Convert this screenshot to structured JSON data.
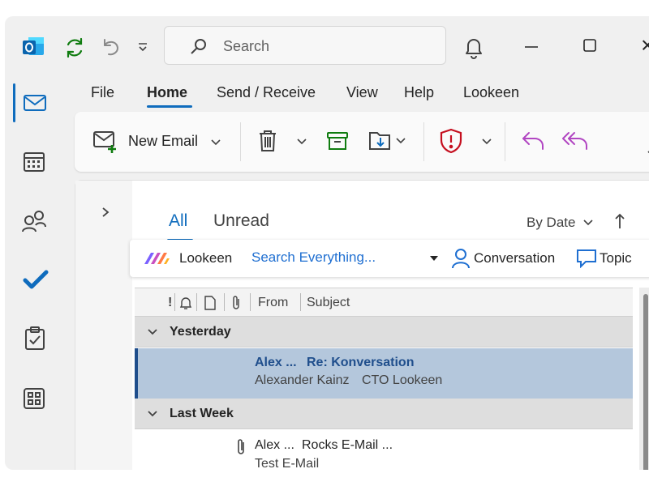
{
  "titlebar": {
    "search_placeholder": "Search",
    "close_glyph": "×"
  },
  "menu": {
    "items": [
      {
        "label": "File"
      },
      {
        "label": "Home"
      },
      {
        "label": "Send / Receive"
      },
      {
        "label": "View"
      },
      {
        "label": "Help"
      },
      {
        "label": "Lookeen"
      }
    ],
    "active": "Home"
  },
  "ribbon": {
    "new_email_label": "New Email"
  },
  "nav_rail": [
    "mail",
    "calendar",
    "people",
    "todo",
    "tasks",
    "apps"
  ],
  "mail_list": {
    "tabs": [
      {
        "label": "All"
      },
      {
        "label": "Unread"
      }
    ],
    "active_tab": "All",
    "sort_label": "By Date"
  },
  "lookeen_bar": {
    "brand_label": "Lookeen",
    "search_placeholder": "Search Everything...",
    "conversation_label": "Conversation",
    "topic_label": "Topic"
  },
  "columns": {
    "importance": "!",
    "from": "From",
    "subject": "Subject"
  },
  "groups": [
    {
      "label": "Yesterday",
      "messages": [
        {
          "from_short": "Alex ...",
          "subject": "Re: Konversation",
          "sender_full": "Alexander Kainz",
          "preview": "CTO Lookeen",
          "selected": true,
          "unread": true
        }
      ]
    },
    {
      "label": "Last Week",
      "messages": [
        {
          "from_short": "Alex ...",
          "subject": "Rocks E-Mail ...",
          "preview": "Test E-Mail",
          "has_attachment": true,
          "selected": false
        }
      ]
    }
  ],
  "colors": {
    "accent": "#0f6cbd",
    "outlook_blue": "#0a64ad",
    "sync_green": "#107c10",
    "selected_row": "#b4c7dc",
    "shield_red": "#c50f1f",
    "reply_purple": "#b146c2"
  }
}
